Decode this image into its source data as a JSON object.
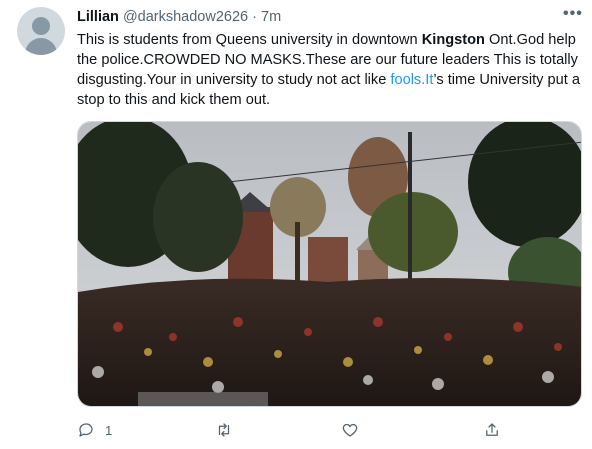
{
  "tweet": {
    "display_name": "Lillian",
    "handle": "@darkshadow2626",
    "separator": "·",
    "time": "7m",
    "more_icon": "more-horizontal-icon",
    "text": {
      "part1": "This is students from Queens university in downtown ",
      "bold": "Kingston",
      "part2": " Ont.God help the police.CROWDED NO MASKS.These are our future leaders This is totally disgusting.Your in university to study not act like ",
      "link": "fools.It",
      "part3": "’s time University put a stop to this and kick them out."
    },
    "media": {
      "icon": "photo-crowd-street",
      "colors": {
        "sky": "#c9ccd0",
        "tree_dark": "#1f2a1c",
        "crowd": "#2c211d",
        "road": "#8a8c8c"
      }
    },
    "actions": {
      "reply_icon": "reply-icon",
      "reply_count": "1",
      "retweet_icon": "retweet-icon",
      "like_icon": "like-icon",
      "share_icon": "share-icon"
    }
  }
}
